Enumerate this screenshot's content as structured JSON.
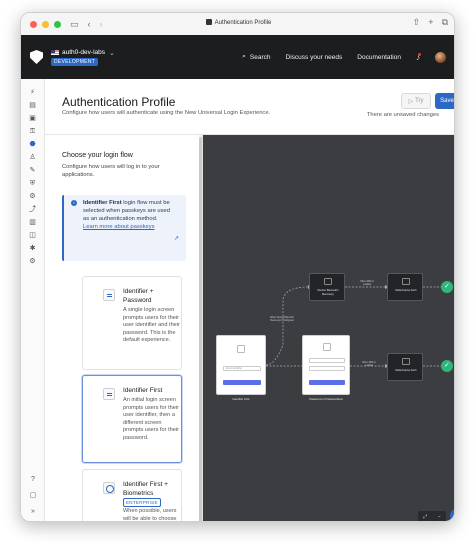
{
  "browser": {
    "tab_title": "Authentication Profile",
    "sidebar_icon": "sidebar-icon",
    "back_icon": "chevron-left-icon",
    "forward_icon": "chevron-right-icon",
    "share_icon": "share-icon",
    "new_tab_icon": "plus-icon",
    "tabs_icon": "tabs-icon"
  },
  "header": {
    "tenant_name": "auth0-dev-labs",
    "environment": "DEVELOPMENT",
    "search_label": "Search",
    "discuss_label": "Discuss your needs",
    "docs_label": "Documentation"
  },
  "page": {
    "title": "Authentication Profile",
    "subtitle": "Configure how users will authenticate using the New Universal Login Experience.",
    "try_label": "Try",
    "save_label": "Save",
    "unsaved_text": "There are unsaved changes"
  },
  "flow_panel": {
    "title": "Choose your login flow",
    "subtitle": "Configure how users will log in to your applications.",
    "info_bold": "Identifier First",
    "info_text": " login flow must be selected when passkeys are used as an authentication method.",
    "info_link": "Learn more about passkeys",
    "options": [
      {
        "title": "Identifier + Password",
        "description": "A single login screen prompts users for their user identifier and their password. This is the default experience."
      },
      {
        "title": "Identifier First",
        "description": "An initial login screen prompts users for their user identifier, then a different screen prompts users for their password."
      },
      {
        "title": "Identifier First + Biometrics",
        "badge": "ENTERPRISE",
        "description": "When possible, users will be able to choose to sign-in using face or"
      }
    ]
  },
  "canvas": {
    "nodes": {
      "identifier_first": "Identifier First",
      "password_or_passwordless": "Password or Passwordless",
      "device_biometric": "Device Biometric Recovery",
      "multi_factor_top": "Multi-Factor Auth",
      "multi_factor_bottom": "Multi-Factor Auth"
    },
    "edge_labels": {
      "when_supported": "When Device Biometric Recovery is configured",
      "mfa_top": "When MFA is enabled",
      "mfa_bottom": "When MFA is enabled"
    },
    "field_placeholder": "Enter identifier",
    "controls": [
      "⤢",
      "−"
    ],
    "help": "?"
  },
  "colors": {
    "brand": "#2d68c4",
    "header_bg": "#1c1d1f",
    "canvas_bg": "#3b3d41",
    "success": "#2fb67c"
  }
}
